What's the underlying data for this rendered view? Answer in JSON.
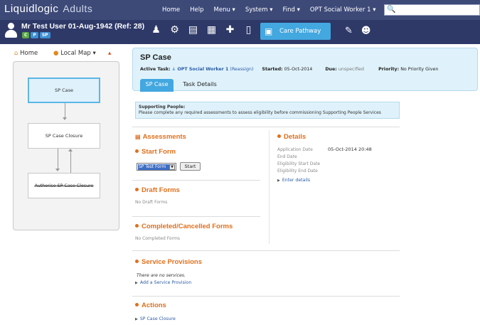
{
  "topbar": {
    "logo": "Liquidlogic",
    "product": "Adults",
    "nav": [
      "Home",
      "Help",
      "Menu ▾",
      "System ▾",
      "Find ▾",
      "OPT Social Worker 1 ▾"
    ]
  },
  "userbar": {
    "user_name": "Mr Test User 01-Aug-1942 (Ref: 28)",
    "badges": [
      "C",
      "P",
      "SP"
    ],
    "care_pathway": "Care Pathway"
  },
  "map": {
    "home": "Home",
    "local_map": "Local Map ▾",
    "nodes": [
      "SP Case",
      "SP Case Closure",
      "Authorise SP Case Closure"
    ]
  },
  "case": {
    "title": "SP Case",
    "active_task_label": "Active Task:",
    "active_task_user": "OPT Social Worker 1",
    "reassign": "(Reassign)",
    "started_label": "Started:",
    "started_value": "05-Oct-2014",
    "due_label": "Due:",
    "due_value": "unspecified",
    "priority_label": "Priority:",
    "priority_value": "No Priority Given",
    "tabs": [
      "SP Case",
      "Task Details"
    ]
  },
  "info": {
    "heading": "Supporting People:",
    "text": "Please complete any required assessments to assess eligibility before commissioning Supporting People Services"
  },
  "assessments": {
    "title": "Assessments",
    "start_form": "Start Form",
    "selected_form": "SP Test Form",
    "start_button": "Start",
    "draft_title": "Draft Forms",
    "draft_empty": "No Draft Forms",
    "completed_title": "Completed/Cancelled Forms",
    "completed_empty": "No Completed Forms"
  },
  "details": {
    "title": "Details",
    "rows": [
      {
        "label": "Application Date",
        "value": "05-Oct-2014 20:48"
      },
      {
        "label": "End Date",
        "value": ""
      },
      {
        "label": "Eligibility Start Date",
        "value": ""
      },
      {
        "label": "Eligibility End Date",
        "value": ""
      }
    ],
    "enter_link": "Enter details"
  },
  "service_provisions": {
    "title": "Service Provisions",
    "empty": "There are no services.",
    "add_link": "Add a Service Provision"
  },
  "actions": {
    "title": "Actions",
    "link": "SP Case Closure"
  }
}
